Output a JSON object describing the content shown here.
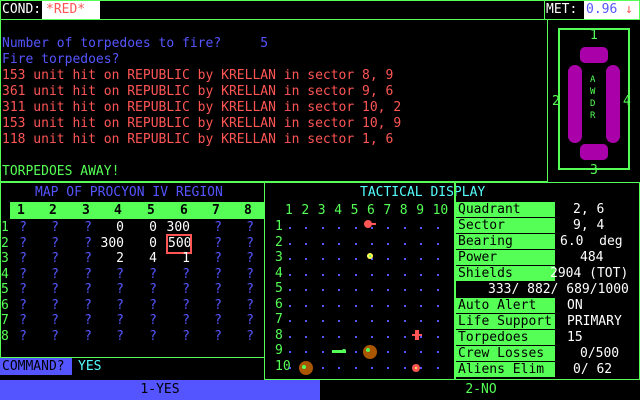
{
  "status": {
    "cond_label": "COND:",
    "cond_value": "*RED*",
    "met_label": "MET:",
    "met_value": "0.96",
    "met_arrow": "↓"
  },
  "log": {
    "prompt1": "Number of torpedoes to fire?     5",
    "prompt2": "Fire torpedoes?",
    "hits": [
      "153 unit hit on REPUBLIC by KRELLAN in sector 8, 9",
      "361 unit hit on REPUBLIC by KRELLAN in sector 9, 6",
      "311 unit hit on REPUBLIC by KRELLAN in sector 10, 2",
      "153 unit hit on REPUBLIC by KRELLAN in sector 10, 9",
      "118 unit hit on REPUBLIC by KRELLAN in sector 1, 6"
    ],
    "result": "TORPEDOES AWAY!"
  },
  "ship": {
    "name_vertical": "AWDR",
    "labels": [
      "1",
      "2",
      "3",
      "4"
    ],
    "colors": {
      "hull": "#aa00aa",
      "nacelle": "#ff55ff",
      "frame": "#55ff55"
    }
  },
  "map": {
    "title": "MAP OF PROCYON IV REGION",
    "columns": [
      "1",
      "2",
      "3",
      "4",
      "5",
      "6",
      "7",
      "8"
    ],
    "rows": [
      [
        "?",
        "?",
        "?",
        "0",
        "0",
        "300",
        "?",
        "?"
      ],
      [
        "?",
        "?",
        "?",
        "300",
        "0",
        "500",
        "?",
        "?"
      ],
      [
        "?",
        "?",
        "?",
        "2",
        "4",
        "1",
        "?",
        "?"
      ],
      [
        "?",
        "?",
        "?",
        "?",
        "?",
        "?",
        "?",
        "?"
      ],
      [
        "?",
        "?",
        "?",
        "?",
        "?",
        "?",
        "?",
        "?"
      ],
      [
        "?",
        "?",
        "?",
        "?",
        "?",
        "?",
        "?",
        "?"
      ],
      [
        "?",
        "?",
        "?",
        "?",
        "?",
        "?",
        "?",
        "?"
      ],
      [
        "?",
        "?",
        "?",
        "?",
        "?",
        "?",
        "?",
        "?"
      ]
    ],
    "row_numbers": [
      "1",
      "2",
      "3",
      "4",
      "5",
      "6",
      "7",
      "8"
    ]
  },
  "tactical": {
    "title": "TACTICAL DISPLAY",
    "columns": [
      "1",
      "2",
      "3",
      "4",
      "5",
      "6",
      "7",
      "8",
      "9",
      "10"
    ],
    "row_numbers": [
      "1",
      "2",
      "3",
      "4",
      "5",
      "6",
      "7",
      "8",
      "9",
      "10"
    ]
  },
  "info": {
    "quadrant_label": "Quadrant",
    "quadrant_value": "2, 6",
    "sector_label": "Sector",
    "sector_value": "9, 4",
    "bearing_label": "Bearing",
    "bearing_value": "6.0  deg",
    "power_label": "Power",
    "power_value": "484",
    "shields_label": "Shields",
    "shields_value": "2904 (TOT)",
    "shields_detail": "333/ 882/ 689/1000",
    "alert_label": "Auto Alert",
    "alert_value": "ON",
    "life_label": "Life Support",
    "life_value": "PRIMARY",
    "torp_label": "Torpedoes",
    "torp_value": "15",
    "crew_label": "Crew Losses",
    "crew_value": "0/500",
    "aliens_label": "Aliens Elim",
    "aliens_value": "0/ 62"
  },
  "command": {
    "label": "COMMAND?",
    "value": "YES",
    "option1": "1-YES",
    "option2": "2-NO"
  }
}
